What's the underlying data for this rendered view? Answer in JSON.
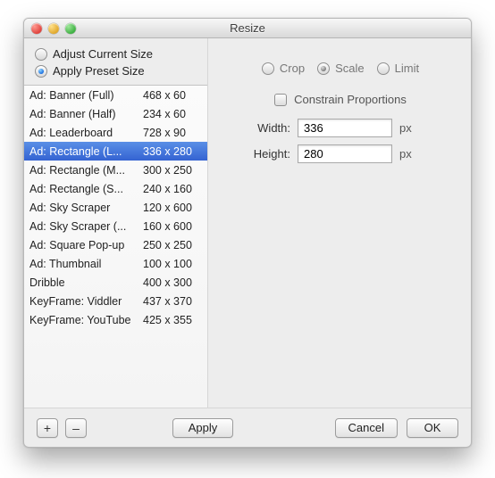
{
  "window": {
    "title": "Resize"
  },
  "traffic": {
    "close": "close-icon",
    "min": "minimize-icon",
    "zoom": "zoom-icon"
  },
  "size_mode": {
    "adjust_label": "Adjust Current Size",
    "apply_label": "Apply Preset Size",
    "selected": "apply"
  },
  "presets": [
    {
      "name": "Ad: Banner (Full)",
      "dims": "468 x 60"
    },
    {
      "name": "Ad: Banner (Half)",
      "dims": "234 x 60"
    },
    {
      "name": "Ad: Leaderboard",
      "dims": "728 x 90"
    },
    {
      "name": "Ad: Rectangle (L...",
      "dims": "336 x 280",
      "selected": true
    },
    {
      "name": "Ad: Rectangle (M...",
      "dims": "300 x 250"
    },
    {
      "name": "Ad: Rectangle (S...",
      "dims": "240 x 160"
    },
    {
      "name": "Ad: Sky Scraper",
      "dims": "120 x 600"
    },
    {
      "name": "Ad: Sky Scraper (...",
      "dims": "160 x 600"
    },
    {
      "name": "Ad: Square Pop-up",
      "dims": "250 x 250"
    },
    {
      "name": "Ad: Thumbnail",
      "dims": "100 x 100"
    },
    {
      "name": "Dribble",
      "dims": "400 x 300"
    },
    {
      "name": "KeyFrame: Viddler",
      "dims": "437 x 370"
    },
    {
      "name": "KeyFrame: YouTube",
      "dims": "425 x 355"
    }
  ],
  "resize_mode": {
    "crop_label": "Crop",
    "scale_label": "Scale",
    "limit_label": "Limit",
    "selected": "scale"
  },
  "constrain": {
    "label": "Constrain Proportions",
    "checked": false
  },
  "fields": {
    "width_label": "Width:",
    "height_label": "Height:",
    "width_value": "336",
    "height_value": "280",
    "unit": "px"
  },
  "buttons": {
    "add": "+",
    "remove": "–",
    "apply": "Apply",
    "cancel": "Cancel",
    "ok": "OK"
  }
}
